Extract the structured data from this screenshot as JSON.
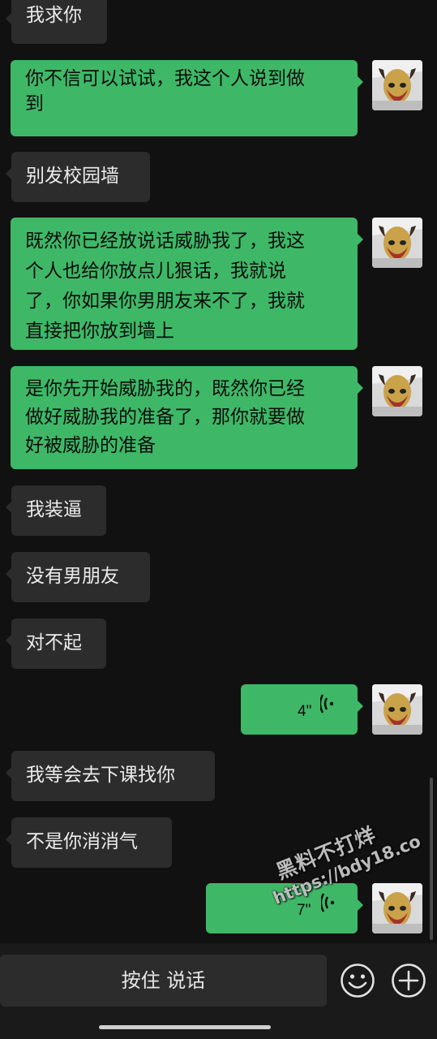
{
  "messages": [
    {
      "side": "left",
      "text": "我求你"
    },
    {
      "side": "right",
      "lines": [
        "你不信可以试试，我这个人说到做",
        "到"
      ]
    },
    {
      "side": "left",
      "text": "别发校园墙"
    },
    {
      "side": "right",
      "lines": [
        "既然你已经放说话威胁我了，我这",
        "个人也给你放点儿狠话，我就说",
        "了，你如果你男朋友来不了，我就",
        "直接把你放到墙上"
      ]
    },
    {
      "side": "right",
      "lines": [
        "是你先开始威胁我的，既然你已经",
        "做好威胁我的准备了，那你就要做",
        "好被威胁的准备"
      ]
    },
    {
      "side": "left",
      "text": "我装逼"
    },
    {
      "side": "left",
      "text": "没有男朋友"
    },
    {
      "side": "left",
      "text": "对不起"
    },
    {
      "side": "right",
      "type": "voice",
      "duration": "4\""
    },
    {
      "side": "left",
      "text": "我等会去下课找你"
    },
    {
      "side": "left",
      "text": "不是你消消气"
    },
    {
      "side": "right",
      "type": "voice",
      "duration": "7\""
    }
  ],
  "watermark": {
    "line1": "黑料不打烊",
    "line2": "https://bdy18.co"
  },
  "input_bar": {
    "hold_to_talk": "按住 说话",
    "emoji_icon": "smiley-face",
    "plus_icon": "circle-plus"
  },
  "colors": {
    "background": "#111111",
    "sent_bubble": "#3eb867",
    "received_bubble": "#2c2c2c"
  }
}
